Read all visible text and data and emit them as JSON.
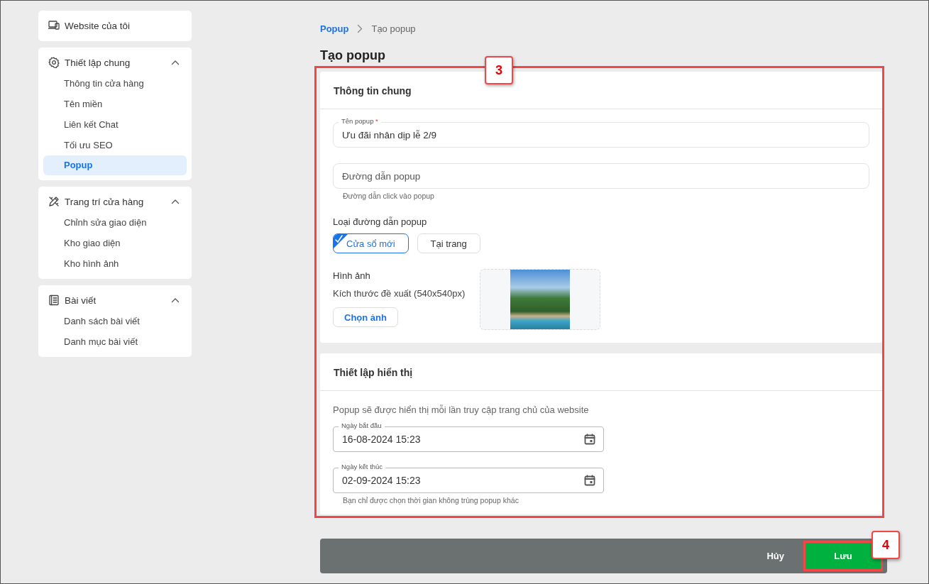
{
  "sidebar": {
    "groups": [
      {
        "kind": "link",
        "title": "Website của tôi"
      },
      {
        "kind": "section",
        "title": "Thiết lập chung",
        "expanded": true,
        "items": [
          {
            "label": "Thông tin cửa hàng",
            "selected": false
          },
          {
            "label": "Tên miền",
            "selected": false
          },
          {
            "label": "Liên kết Chat",
            "selected": false
          },
          {
            "label": "Tối ưu SEO",
            "selected": false
          },
          {
            "label": "Popup",
            "selected": true
          }
        ]
      },
      {
        "kind": "section",
        "title": "Trang trí cửa hàng",
        "expanded": true,
        "items": [
          {
            "label": "Chỉnh sửa giao diện",
            "selected": false
          },
          {
            "label": "Kho giao diện",
            "selected": false
          },
          {
            "label": "Kho hình ảnh",
            "selected": false
          }
        ]
      },
      {
        "kind": "section",
        "title": "Bài viết",
        "expanded": true,
        "items": [
          {
            "label": "Danh sách bài viết",
            "selected": false
          },
          {
            "label": "Danh mục bài viết",
            "selected": false
          }
        ]
      }
    ]
  },
  "breadcrumb": [
    {
      "label": "Popup",
      "kind": "link"
    },
    {
      "label": "Tạo popup",
      "kind": "current"
    }
  ],
  "page_title": "Tạo popup",
  "general_card": {
    "title": "Thông tin chung",
    "name_field": {
      "label": "Tên popup",
      "required_mark": "*",
      "value": "Ưu đãi nhân dịp lễ 2/9"
    },
    "link_field": {
      "placeholder": "Đường dẫn popup",
      "helper": "Đường dẫn click vào popup"
    },
    "link_type": {
      "label": "Loại đường dẫn popup",
      "options": [
        {
          "label": "Cửa sổ mới",
          "selected": true
        },
        {
          "label": "Tại trang",
          "selected": false
        }
      ]
    },
    "image": {
      "label": "Hình ảnh",
      "hint": "Kích thước đề xuất (540x540px)",
      "button": "Chọn ảnh"
    }
  },
  "display_card": {
    "title": "Thiết lập hiển thị",
    "description": "Popup sẽ được hiển thị mỗi lần truy cập trang chủ của website",
    "date_fields": [
      {
        "label": "Ngày bắt đầu",
        "value": "16-08-2024 15:23"
      },
      {
        "label": "Ngày kết thúc",
        "value": "02-09-2024 15:23"
      }
    ],
    "helper": "Bạn chỉ được chọn thời gian không trùng popup khác"
  },
  "footer": {
    "cancel": "Hủy",
    "save": "Lưu"
  },
  "callouts": [
    {
      "label": "3"
    },
    {
      "label": "4"
    }
  ]
}
